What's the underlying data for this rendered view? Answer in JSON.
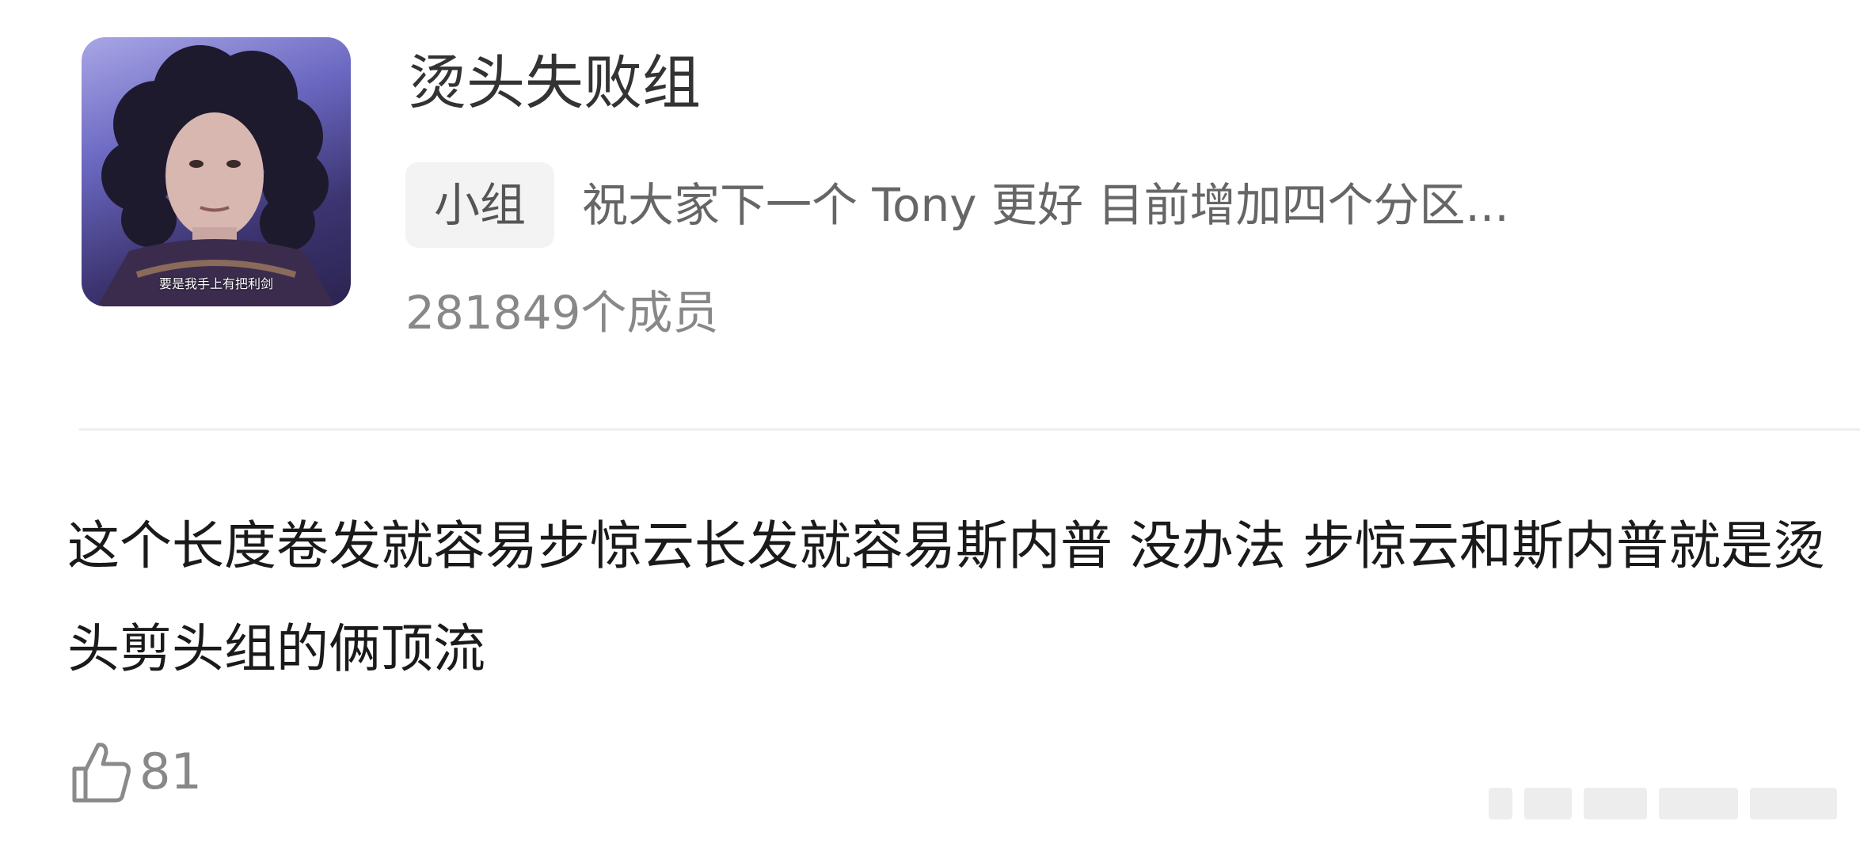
{
  "group": {
    "name": "烫头失败组",
    "tag": "小组",
    "description": "祝大家下一个 Tony 更好  目前增加四个分区...",
    "member_count": "281849个成员",
    "avatar_caption": "要是我手上有把利剑"
  },
  "post": {
    "body": "这个长度卷发就容易步惊云长发就容易斯内普 没办法 步惊云和斯内普就是烫头剪头组的俩顶流",
    "like_count": "81"
  },
  "icons": {
    "like": "thumbs-up-icon"
  },
  "colors": {
    "title_text": "#333333",
    "secondary_text": "#888888",
    "body_text": "#1a1a1a",
    "tag_background": "#f3f3f3",
    "divider": "#eeeeee"
  }
}
